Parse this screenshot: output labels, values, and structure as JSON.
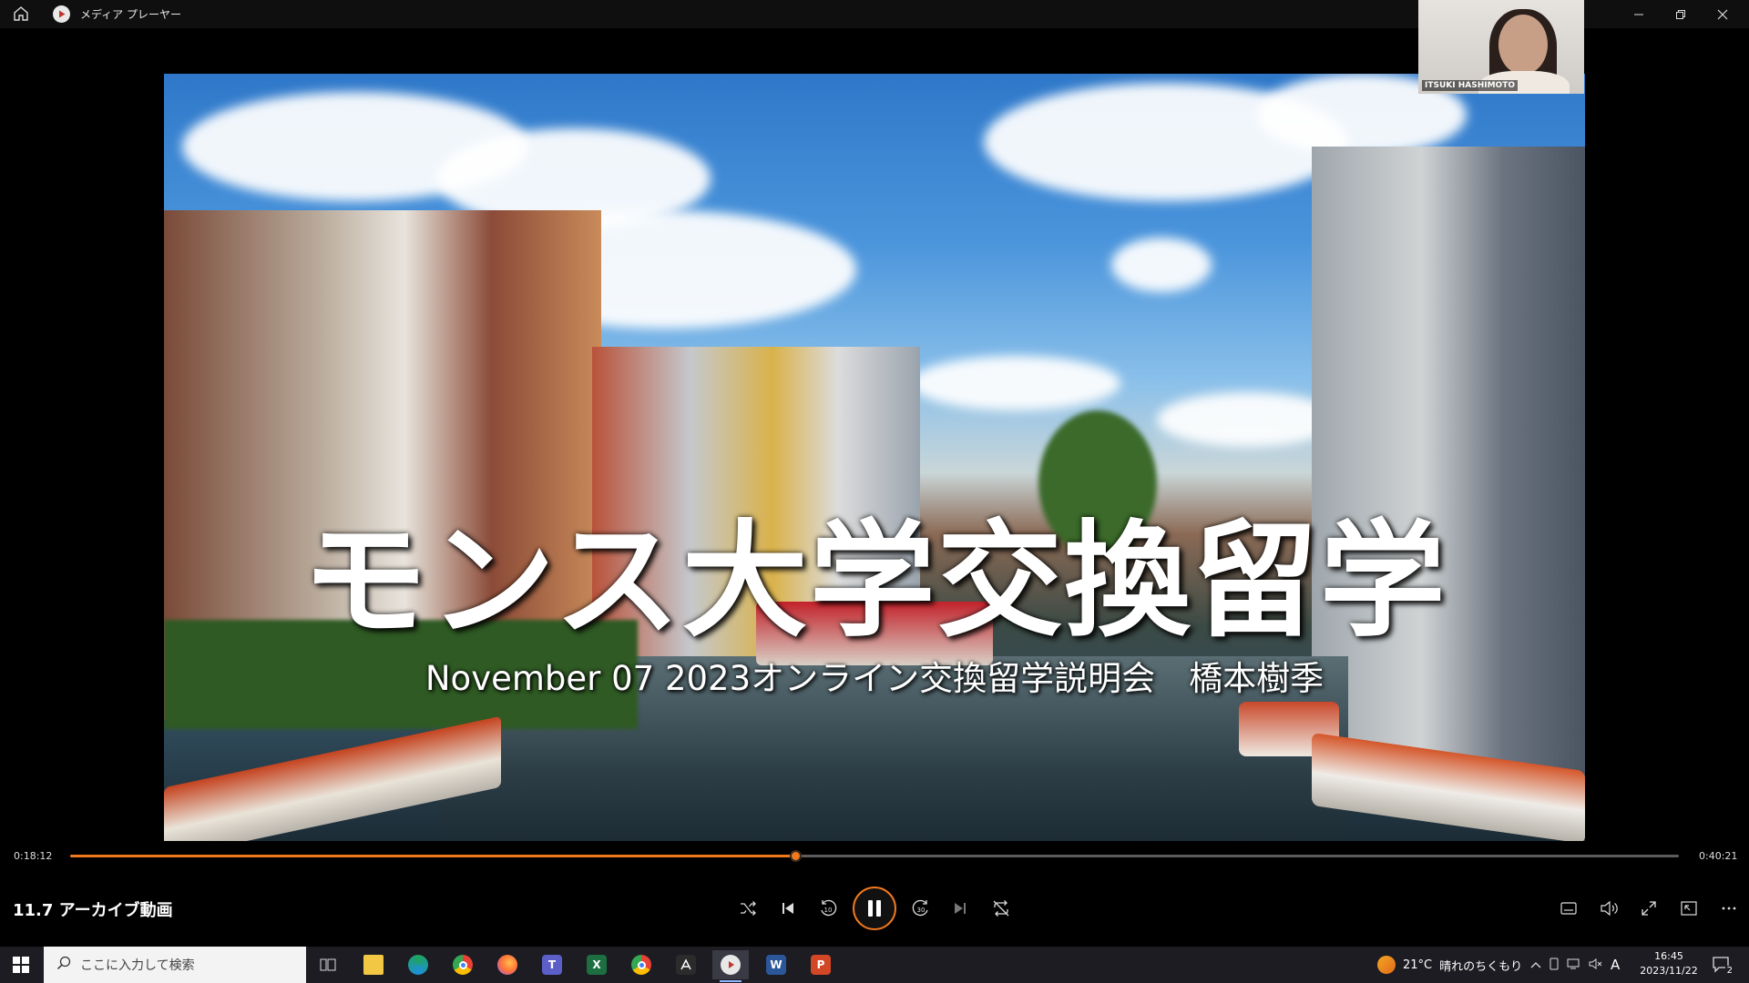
{
  "window": {
    "title": "メディア プレーヤー",
    "controls": [
      "minimize",
      "restore",
      "close"
    ]
  },
  "slide": {
    "title": "モンス大学交換留学",
    "subtitle": "November 07 2023オンライン交換留学説明会　橋本樹季"
  },
  "webcam": {
    "name": "ITSUKI HASHIMOTO"
  },
  "playback": {
    "current_time": "0:18:12",
    "total_time": "0:40:21",
    "progress": 0.451,
    "state": "playing"
  },
  "controls": {
    "video_title": "11.7 アーカイブ動画",
    "left_icons": [
      "shuffle-icon",
      "previous-icon",
      "skip-back-10-icon",
      "pause-icon",
      "skip-forward-30-icon",
      "next-icon",
      "repeat-off-icon"
    ],
    "skip_back_label": "10",
    "skip_forward_label": "30",
    "right_icons": [
      "captions-icon",
      "volume-icon",
      "fullscreen-icon",
      "miniplayer-icon",
      "more-icon"
    ]
  },
  "taskbar": {
    "search_placeholder": "ここに入力して検索",
    "apps": [
      {
        "name": "task-view-icon"
      },
      {
        "name": "file-explorer-icon",
        "color": "#f2c744"
      },
      {
        "name": "edge-icon",
        "color": "#1fa35e"
      },
      {
        "name": "chrome-icon",
        "color": "#e94235"
      },
      {
        "name": "firefox-icon",
        "color": "#ff7139"
      },
      {
        "name": "teams-icon",
        "color": "#5b5fc7",
        "label": "T"
      },
      {
        "name": "excel-icon",
        "color": "#1d6f42",
        "label": "X"
      },
      {
        "name": "chrome-icon",
        "color": "#e94235"
      },
      {
        "name": "acrobat-icon",
        "color": "#333333"
      },
      {
        "name": "media-player-icon",
        "color": "#e8e8e8"
      },
      {
        "name": "word-icon",
        "color": "#2b579a",
        "label": "W"
      },
      {
        "name": "powerpoint-icon",
        "color": "#d24726",
        "label": "P"
      }
    ],
    "weather_temp": "21°C",
    "weather_text": "晴れのちくもり",
    "ime": "A",
    "time": "16:45",
    "date": "2023/11/22",
    "notification_count": "2"
  },
  "colors": {
    "accent": "#f0781e",
    "taskbar": "#1c1c22"
  }
}
